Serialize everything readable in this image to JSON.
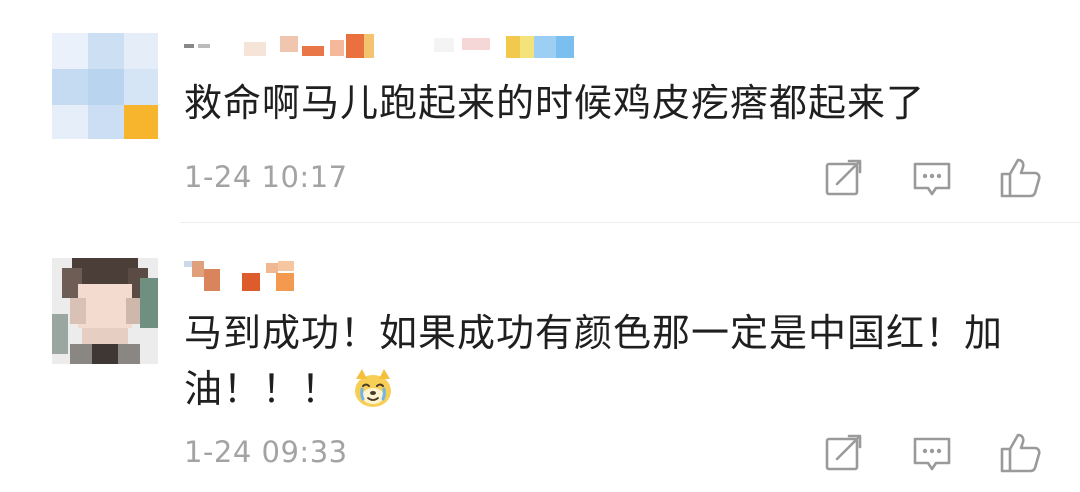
{
  "comments": [
    {
      "text": "救命啊马儿跑起来的时候鸡皮疙瘩都起来了",
      "time": "1-24 10:17",
      "avatar_colors": [
        "#d9e7f5",
        "#c4dbf0",
        "#e3ecf7",
        "#b7d2ee",
        "#eef3fa",
        "#cfe0f3",
        "#f5b52e"
      ],
      "username_colors": [
        "#d1d1d1",
        "#f2c3a6",
        "#e86d3d",
        "#f7d8c8",
        "#f3b25f",
        "#b6d8f5",
        "#f6d34c"
      ]
    },
    {
      "text": "马到成功！如果成功有颜色那一定是中国红！加油！！！",
      "time": "1-24 09:33",
      "emoji": "dog-face-emoji",
      "avatar_colors": [
        "#5a4a42",
        "#8d7b70",
        "#f1d7c8",
        "#d7c3b6",
        "#6a8b7c",
        "#3b3430"
      ],
      "username_colors": [
        "#d9885a",
        "#e7a27a",
        "#de5b2b",
        "#f3a166"
      ]
    }
  ],
  "icons": {
    "share": "share-icon",
    "reply": "comment-icon",
    "like": "thumbs-up-icon"
  },
  "colors": {
    "text": "#1f1f1f",
    "meta": "#a3a3a3",
    "icon": "#9a9a9a",
    "divider": "#eeeeee"
  }
}
